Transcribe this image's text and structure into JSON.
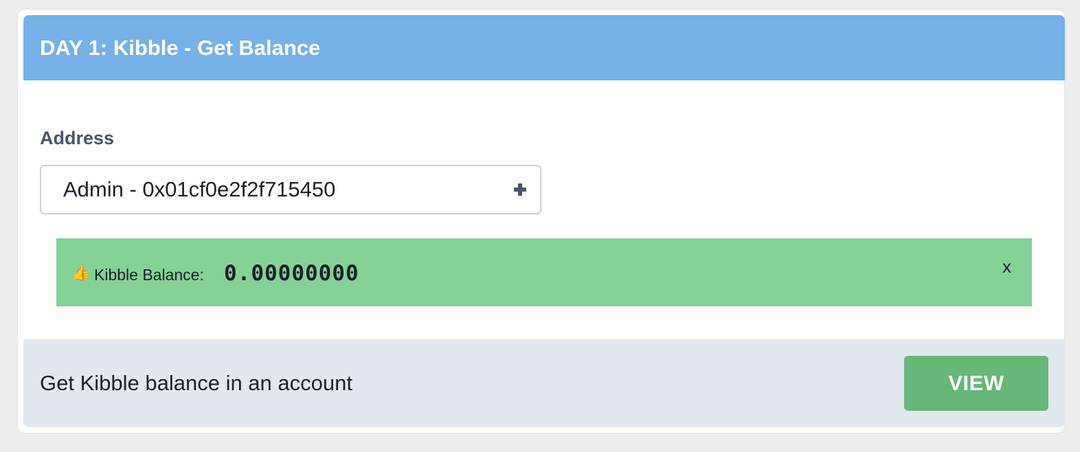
{
  "header": {
    "title": "DAY 1: Kibble - Get Balance"
  },
  "form": {
    "address_label": "Address",
    "address_selected": "Admin - 0x01cf0e2f2f715450",
    "address_icon": "plus-icon"
  },
  "alert": {
    "icon": "👍",
    "icon_name": "thumbs-up-icon",
    "label": "Kibble Balance:",
    "value": "0.00000000",
    "close_label": "x"
  },
  "footer": {
    "description": "Get Kibble balance in an account",
    "button_label": "VIEW"
  },
  "colors": {
    "header_bg": "#76b1e7",
    "alert_bg": "#85d196",
    "footer_bg": "#e3e7ee",
    "button_bg": "#67b77a"
  }
}
